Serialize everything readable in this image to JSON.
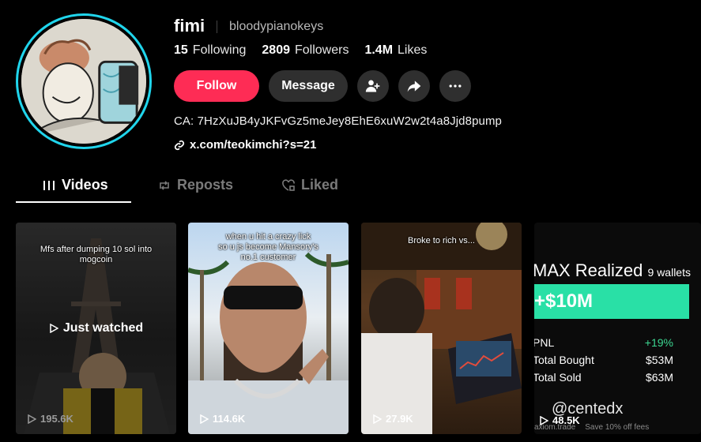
{
  "profile": {
    "username": "fimi",
    "handle": "bloodypianokeys",
    "following_count": "15",
    "following_label": "Following",
    "followers_count": "2809",
    "followers_label": "Followers",
    "likes_count": "1.4M",
    "likes_label": "Likes",
    "bio": "CA: 7HzXuJB4yJKFvGz5meJey8EhE6xuW2w2t4a8Jjd8pump",
    "link": "x.com/teokimchi?s=21"
  },
  "actions": {
    "follow_label": "Follow",
    "message_label": "Message"
  },
  "tabs": [
    {
      "label": "Videos",
      "icon": "grid-icon",
      "active": true
    },
    {
      "label": "Reposts",
      "icon": "repost-icon",
      "active": false
    },
    {
      "label": "Liked",
      "icon": "heart-lock-icon",
      "active": false
    }
  ],
  "videos": [
    {
      "caption": "Mfs after dumping 10 sol into\nmogcoin",
      "views": "195.6K",
      "overlay": "Just watched"
    },
    {
      "caption": "when u hit a crazy lick\nso u js become Mansory's\nno.1 customer",
      "views": "114.6K"
    },
    {
      "caption": "Broke to rich vs...",
      "views": "27.9K"
    },
    {
      "views": "48.5K",
      "title": "MAX Realized",
      "title_suffix": "9 wallets",
      "amount": "+$10M",
      "rows": [
        {
          "label": "PNL",
          "value": "+19%"
        },
        {
          "label": "Total Bought",
          "value": "$53M"
        },
        {
          "label": "Total Sold",
          "value": "$63M"
        }
      ],
      "tag": "@centedx",
      "footer_site": "axiom.trade",
      "footer_promo": "Save 10% off fees"
    }
  ],
  "colors": {
    "accent": "#fe2c55",
    "ring": "#20d5ec",
    "pnl_green": "#3cd892",
    "bar_green": "#29e0a6"
  }
}
